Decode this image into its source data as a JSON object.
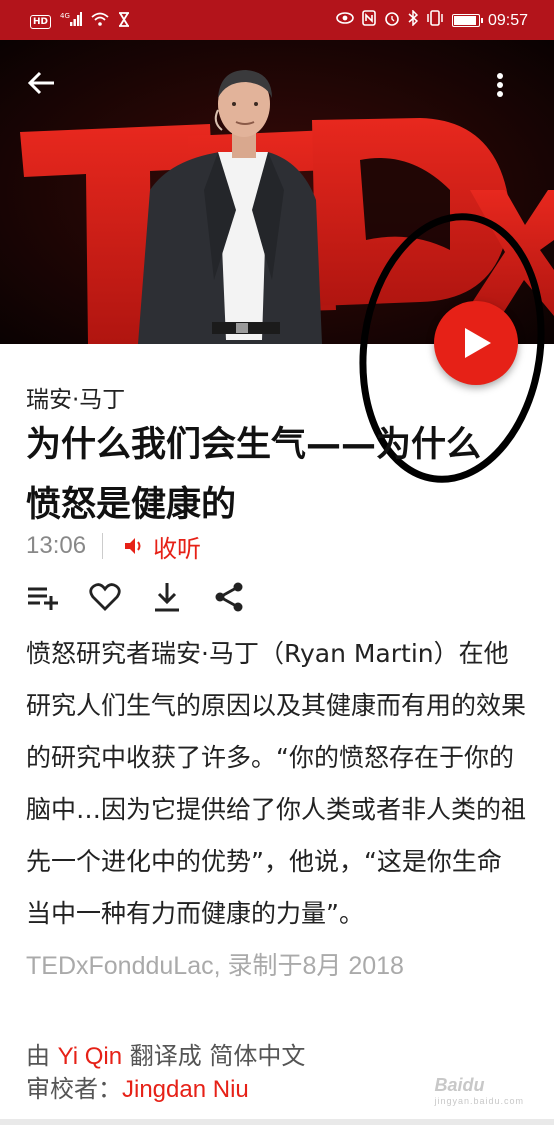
{
  "status_bar": {
    "left_icons": [
      "hd-badge",
      "signal-4g-icon",
      "wifi-icon",
      "hourglass-icon"
    ],
    "hd_label": "HD",
    "net_label": "4G",
    "right_icons": [
      "eye-icon",
      "nfc-icon",
      "alarm-icon",
      "bluetooth-icon",
      "vibrate-icon",
      "battery-icon"
    ],
    "battery_level": 0.85,
    "time": "09:57"
  },
  "hero": {
    "background_text": "TEDx",
    "accent_color": "#e62117"
  },
  "talk": {
    "speaker": "瑞安·马丁",
    "title": "为什么我们会生气——为什么愤怒是健康的",
    "duration": "13:06",
    "listen_label": "收听"
  },
  "actions": [
    "add-to-list-icon",
    "heart-icon",
    "download-icon",
    "share-icon"
  ],
  "description": {
    "text": "愤怒研究者瑞安·马丁（Ryan Martin）在他研究人们生气的原因以及其健康而有用的效果的研究中收获了许多。“你的愤怒存在于你的脑中…因为它提供给了你人类或者非人类的祖先一个进化中的优势”，他说，“这是你生命当中一种有力而健康的力量”。",
    "event": "TEDxFondduLac, 录制于8月 2018"
  },
  "credits": {
    "by_prefix": "由 ",
    "translator": "Yi Qin",
    "translated_to": " 翻译成 简体中文",
    "reviewer_prefix": "审校者：",
    "reviewer": "Jingdan Niu"
  },
  "watermark": {
    "logo": "Baidu",
    "sub": "jingyan.baidu.com"
  }
}
